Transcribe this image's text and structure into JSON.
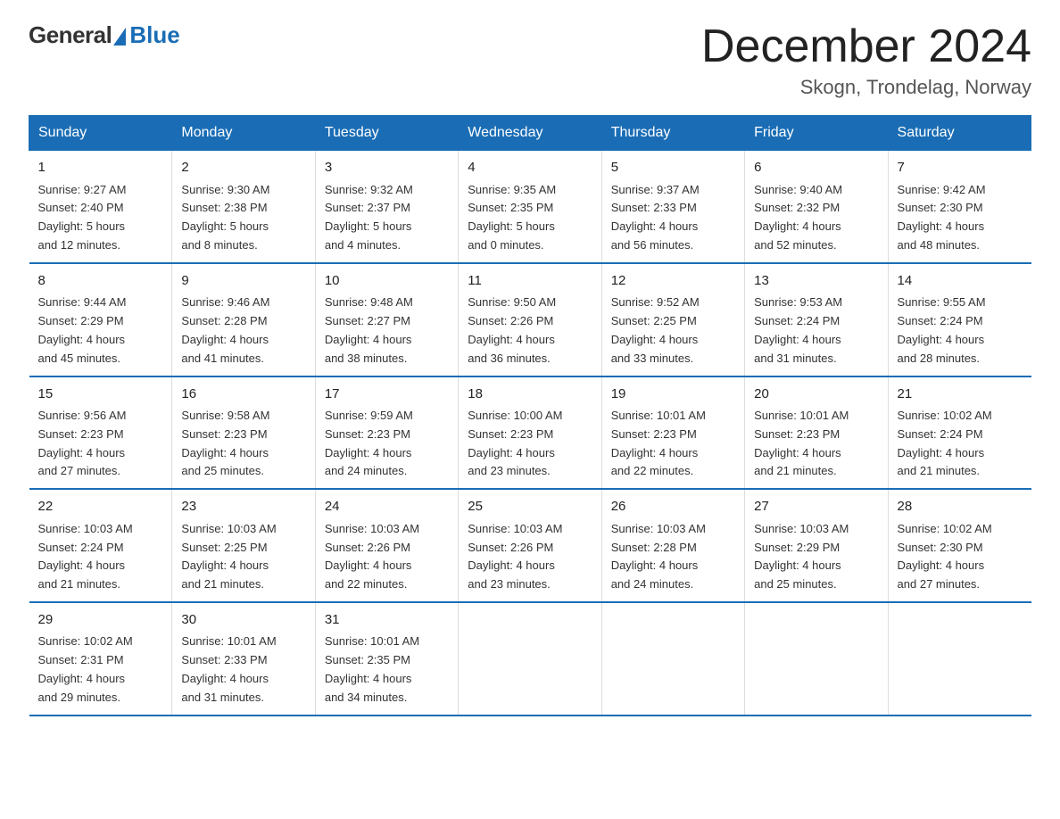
{
  "logo": {
    "general": "General",
    "blue": "Blue",
    "subtitle": ""
  },
  "header": {
    "month_title": "December 2024",
    "location": "Skogn, Trondelag, Norway"
  },
  "days_of_week": [
    "Sunday",
    "Monday",
    "Tuesday",
    "Wednesday",
    "Thursday",
    "Friday",
    "Saturday"
  ],
  "weeks": [
    [
      {
        "day": "1",
        "sunrise": "9:27 AM",
        "sunset": "2:40 PM",
        "daylight": "5 hours and 12 minutes."
      },
      {
        "day": "2",
        "sunrise": "9:30 AM",
        "sunset": "2:38 PM",
        "daylight": "5 hours and 8 minutes."
      },
      {
        "day": "3",
        "sunrise": "9:32 AM",
        "sunset": "2:37 PM",
        "daylight": "5 hours and 4 minutes."
      },
      {
        "day": "4",
        "sunrise": "9:35 AM",
        "sunset": "2:35 PM",
        "daylight": "5 hours and 0 minutes."
      },
      {
        "day": "5",
        "sunrise": "9:37 AM",
        "sunset": "2:33 PM",
        "daylight": "4 hours and 56 minutes."
      },
      {
        "day": "6",
        "sunrise": "9:40 AM",
        "sunset": "2:32 PM",
        "daylight": "4 hours and 52 minutes."
      },
      {
        "day": "7",
        "sunrise": "9:42 AM",
        "sunset": "2:30 PM",
        "daylight": "4 hours and 48 minutes."
      }
    ],
    [
      {
        "day": "8",
        "sunrise": "9:44 AM",
        "sunset": "2:29 PM",
        "daylight": "4 hours and 45 minutes."
      },
      {
        "day": "9",
        "sunrise": "9:46 AM",
        "sunset": "2:28 PM",
        "daylight": "4 hours and 41 minutes."
      },
      {
        "day": "10",
        "sunrise": "9:48 AM",
        "sunset": "2:27 PM",
        "daylight": "4 hours and 38 minutes."
      },
      {
        "day": "11",
        "sunrise": "9:50 AM",
        "sunset": "2:26 PM",
        "daylight": "4 hours and 36 minutes."
      },
      {
        "day": "12",
        "sunrise": "9:52 AM",
        "sunset": "2:25 PM",
        "daylight": "4 hours and 33 minutes."
      },
      {
        "day": "13",
        "sunrise": "9:53 AM",
        "sunset": "2:24 PM",
        "daylight": "4 hours and 31 minutes."
      },
      {
        "day": "14",
        "sunrise": "9:55 AM",
        "sunset": "2:24 PM",
        "daylight": "4 hours and 28 minutes."
      }
    ],
    [
      {
        "day": "15",
        "sunrise": "9:56 AM",
        "sunset": "2:23 PM",
        "daylight": "4 hours and 27 minutes."
      },
      {
        "day": "16",
        "sunrise": "9:58 AM",
        "sunset": "2:23 PM",
        "daylight": "4 hours and 25 minutes."
      },
      {
        "day": "17",
        "sunrise": "9:59 AM",
        "sunset": "2:23 PM",
        "daylight": "4 hours and 24 minutes."
      },
      {
        "day": "18",
        "sunrise": "10:00 AM",
        "sunset": "2:23 PM",
        "daylight": "4 hours and 23 minutes."
      },
      {
        "day": "19",
        "sunrise": "10:01 AM",
        "sunset": "2:23 PM",
        "daylight": "4 hours and 22 minutes."
      },
      {
        "day": "20",
        "sunrise": "10:01 AM",
        "sunset": "2:23 PM",
        "daylight": "4 hours and 21 minutes."
      },
      {
        "day": "21",
        "sunrise": "10:02 AM",
        "sunset": "2:24 PM",
        "daylight": "4 hours and 21 minutes."
      }
    ],
    [
      {
        "day": "22",
        "sunrise": "10:03 AM",
        "sunset": "2:24 PM",
        "daylight": "4 hours and 21 minutes."
      },
      {
        "day": "23",
        "sunrise": "10:03 AM",
        "sunset": "2:25 PM",
        "daylight": "4 hours and 21 minutes."
      },
      {
        "day": "24",
        "sunrise": "10:03 AM",
        "sunset": "2:26 PM",
        "daylight": "4 hours and 22 minutes."
      },
      {
        "day": "25",
        "sunrise": "10:03 AM",
        "sunset": "2:26 PM",
        "daylight": "4 hours and 23 minutes."
      },
      {
        "day": "26",
        "sunrise": "10:03 AM",
        "sunset": "2:28 PM",
        "daylight": "4 hours and 24 minutes."
      },
      {
        "day": "27",
        "sunrise": "10:03 AM",
        "sunset": "2:29 PM",
        "daylight": "4 hours and 25 minutes."
      },
      {
        "day": "28",
        "sunrise": "10:02 AM",
        "sunset": "2:30 PM",
        "daylight": "4 hours and 27 minutes."
      }
    ],
    [
      {
        "day": "29",
        "sunrise": "10:02 AM",
        "sunset": "2:31 PM",
        "daylight": "4 hours and 29 minutes."
      },
      {
        "day": "30",
        "sunrise": "10:01 AM",
        "sunset": "2:33 PM",
        "daylight": "4 hours and 31 minutes."
      },
      {
        "day": "31",
        "sunrise": "10:01 AM",
        "sunset": "2:35 PM",
        "daylight": "4 hours and 34 minutes."
      },
      null,
      null,
      null,
      null
    ]
  ],
  "labels": {
    "sunrise_prefix": "Sunrise: ",
    "sunset_prefix": "Sunset: ",
    "daylight_prefix": "Daylight: "
  }
}
